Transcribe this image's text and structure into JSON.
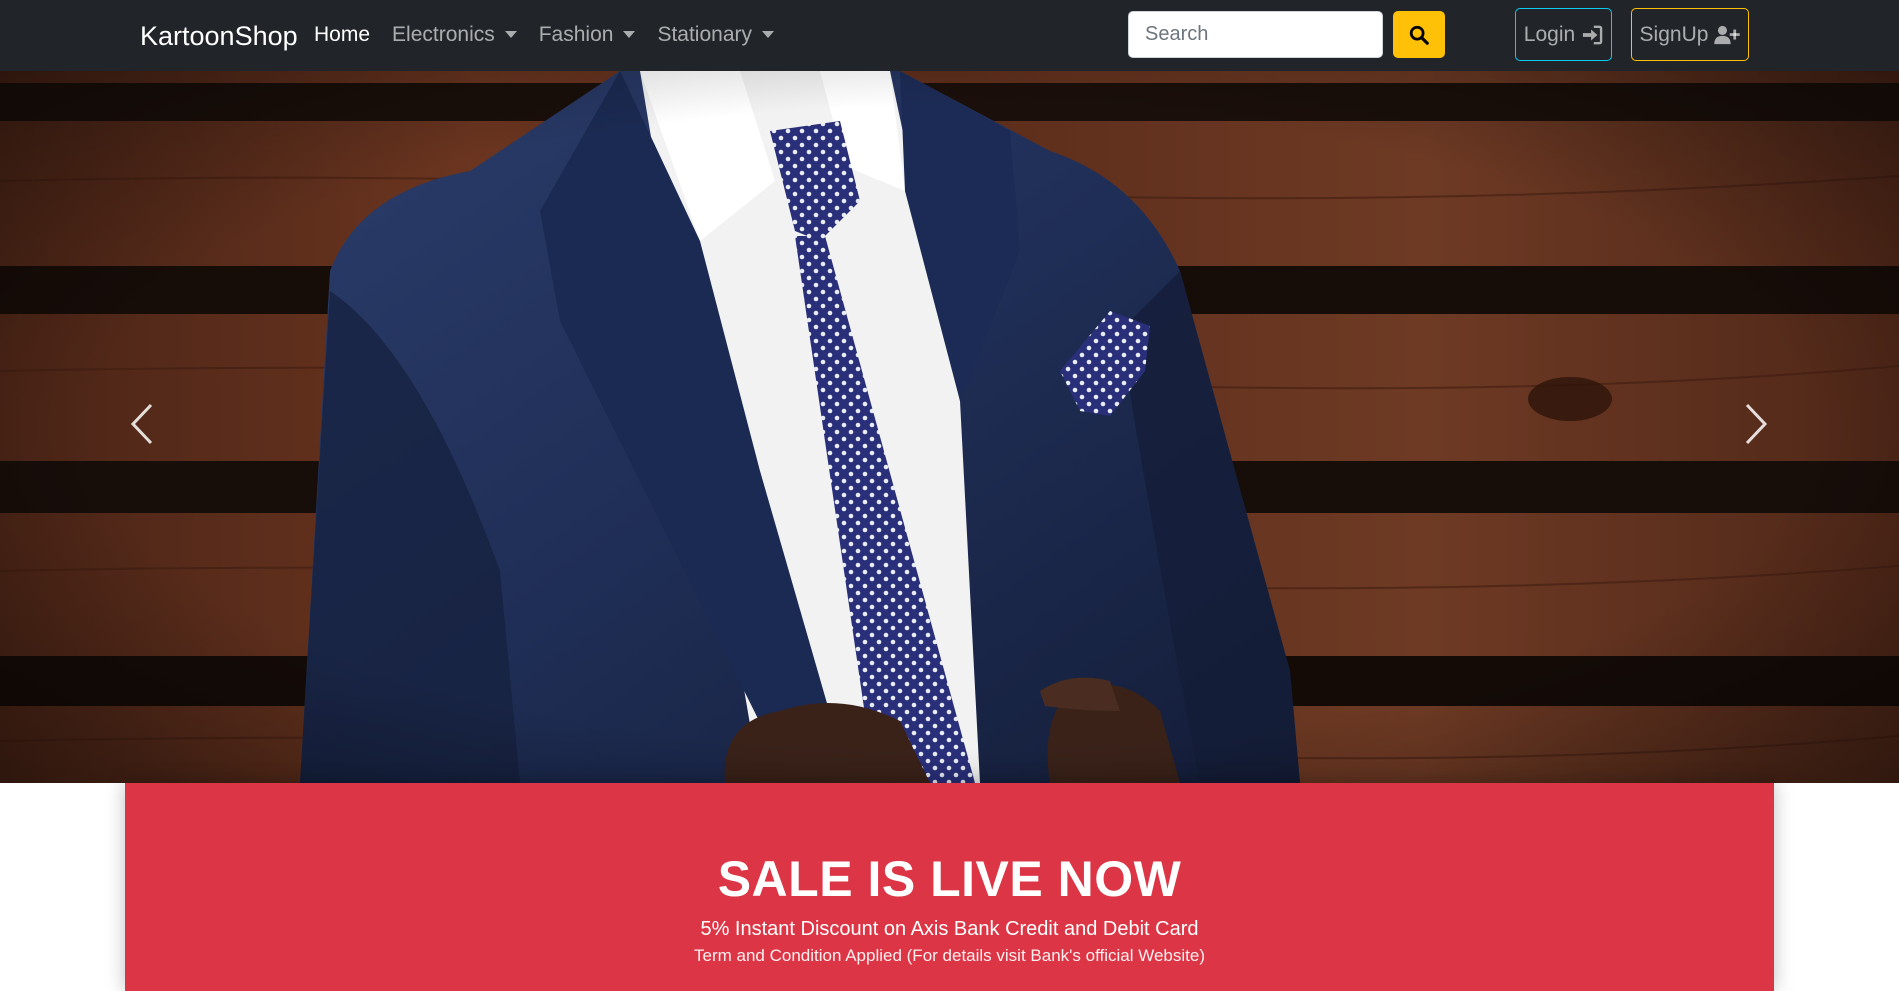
{
  "navbar": {
    "brand": "KartoonShop",
    "items": [
      {
        "label": "Home",
        "active": true,
        "dropdown": false
      },
      {
        "label": "Electronics",
        "active": false,
        "dropdown": true
      },
      {
        "label": "Fashion",
        "active": false,
        "dropdown": true
      },
      {
        "label": "Stationary",
        "active": false,
        "dropdown": true
      }
    ],
    "search": {
      "placeholder": "Search",
      "value": "",
      "button_icon": "search-icon"
    },
    "login": {
      "label": "Login",
      "icon": "sign-in-icon",
      "border_color": "#0dcaf0"
    },
    "signup": {
      "label": "SignUp",
      "icon": "user-plus-icon",
      "border_color": "#ffc107"
    },
    "background": "#212529"
  },
  "hero": {
    "image_subject": "man in navy suit with polka-dot tie against wooden wall",
    "prev_icon": "chevron-left-icon",
    "next_icon": "chevron-right-icon"
  },
  "sale": {
    "title": "SALE IS LIVE NOW",
    "subtitle": "5% Instant Discount on Axis Bank Credit and Debit Card",
    "terms": "Term and Condition Applied (For details visit Bank's official Website)",
    "background": "#dc3545"
  },
  "colors": {
    "accent_warning": "#ffc107",
    "accent_info": "#0dcaf0",
    "danger": "#dc3545"
  }
}
